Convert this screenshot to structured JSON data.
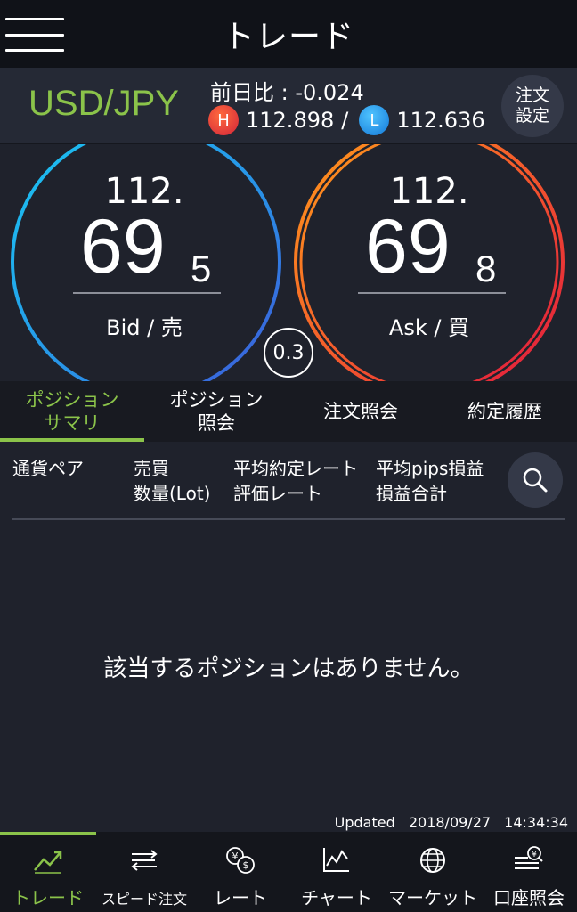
{
  "header": {
    "title": "トレード",
    "menu_icon": "hamburger-menu-icon"
  },
  "pair": {
    "name": "USD/JPY",
    "prev_diff": "前日比 : -0.024",
    "high_badge": "H",
    "high": "112.898",
    "separator": "/",
    "low_badge": "L",
    "low": "112.636",
    "order_settings_line1": "注文",
    "order_settings_line2": "設定"
  },
  "bid": {
    "top": "112.",
    "main": "69",
    "small": "5",
    "label": "Bid / 売"
  },
  "ask": {
    "top": "112.",
    "main": "69",
    "small": "8",
    "label": "Ask / 買"
  },
  "spread": "0.3",
  "tabs": [
    {
      "line1": "ポジション",
      "line2": "サマリ",
      "active": true
    },
    {
      "line1": "ポジション",
      "line2": "照会",
      "active": false
    },
    {
      "line1": "注文照会",
      "line2": "",
      "active": false
    },
    {
      "line1": "約定履歴",
      "line2": "",
      "active": false
    }
  ],
  "columns": {
    "pair": "通貨ペア",
    "side": "売買",
    "qty": "数量(Lot)",
    "avg_rate": "平均約定レート",
    "eval_rate": "評価レート",
    "avg_pips": "平均pips損益",
    "pl_total": "損益合計"
  },
  "empty_message": "該当するポジションはありません。",
  "updated": {
    "label": "Updated",
    "date": "2018/09/27",
    "time": "14:34:34"
  },
  "nav": [
    {
      "label": "トレード",
      "icon": "trade-chart-icon",
      "active": true
    },
    {
      "label": "スピード注文",
      "icon": "speed-order-icon",
      "active": false
    },
    {
      "label": "レート",
      "icon": "rate-currency-icon",
      "active": false
    },
    {
      "label": "チャート",
      "icon": "chart-icon",
      "active": false
    },
    {
      "label": "マーケット",
      "icon": "globe-icon",
      "active": false
    },
    {
      "label": "口座照会",
      "icon": "account-icon",
      "active": false
    }
  ],
  "colors": {
    "accent": "#8bc34a",
    "background": "#1f222c",
    "high": "#e53935",
    "low": "#1e88e5"
  }
}
